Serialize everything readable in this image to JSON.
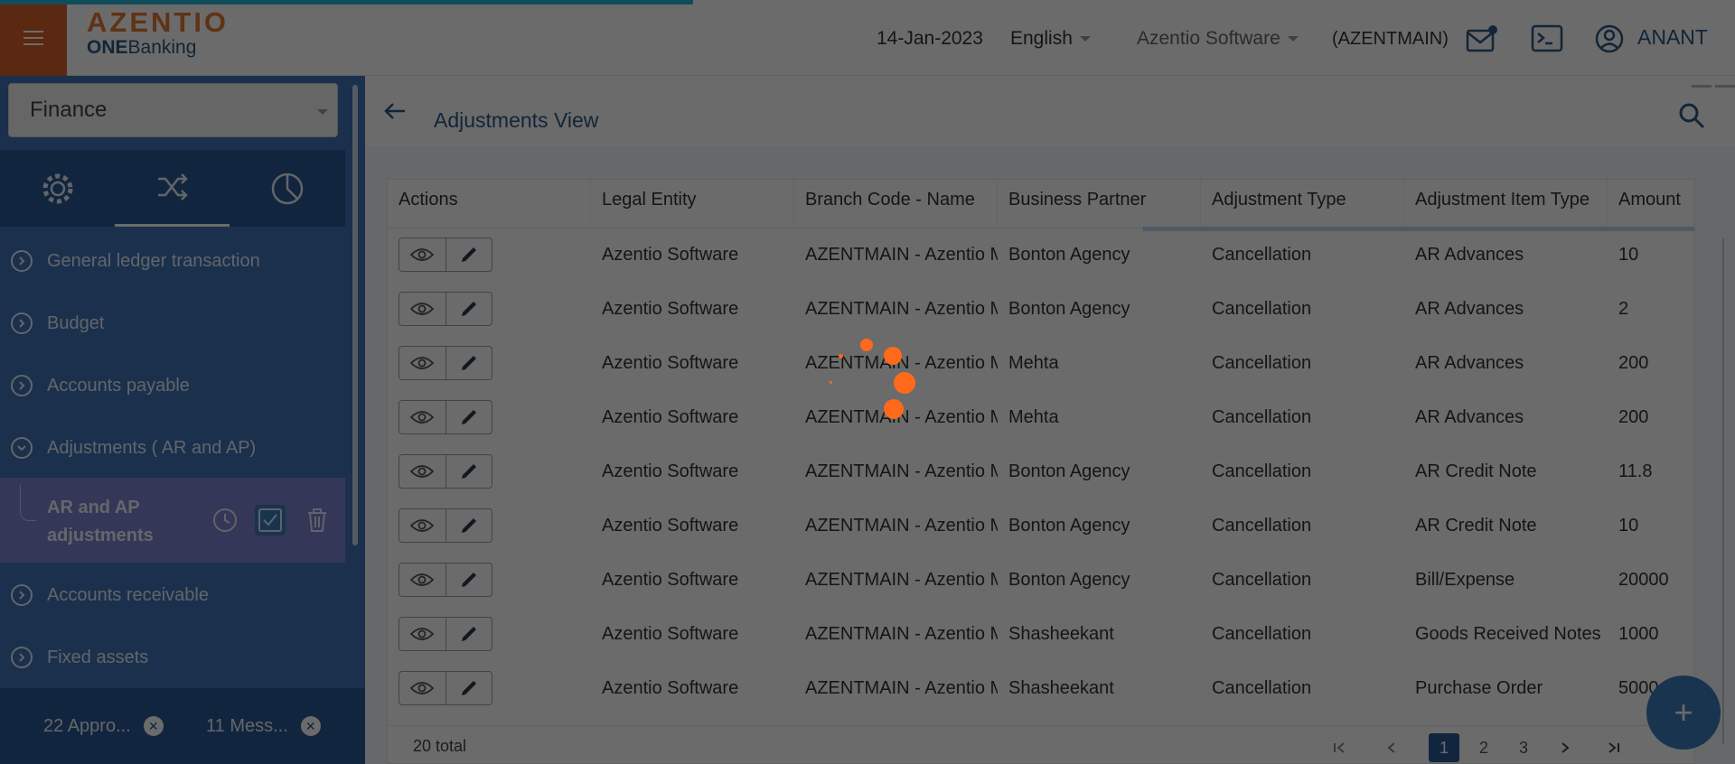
{
  "header": {
    "brand": "AZENTIO",
    "product_prefix": "ONE",
    "product_suffix": "Banking",
    "date": "14-Jan-2023",
    "language": "English",
    "company": "Azentio Software",
    "branch_code": "(AZENTMAIN)",
    "user": "ANANT"
  },
  "sidebar": {
    "module": "Finance",
    "tabs": [
      "settings-gear",
      "shuffle",
      "pie-chart"
    ],
    "items": [
      {
        "label": "General ledger transaction",
        "expanded": false
      },
      {
        "label": "Budget",
        "expanded": false
      },
      {
        "label": "Accounts payable",
        "expanded": false
      },
      {
        "label": "Adjustments ( AR and AP)",
        "expanded": true
      },
      {
        "label": "Accounts receivable",
        "expanded": false
      },
      {
        "label": "Fixed assets",
        "expanded": false
      }
    ],
    "sub_item": {
      "label": "AR and AP adjustments"
    },
    "bottom_pills": [
      {
        "label": "22 Appro..."
      },
      {
        "label": "11 Mess..."
      }
    ]
  },
  "main": {
    "title": "Adjustments View",
    "columns": [
      "Actions",
      "Legal Entity",
      "Branch Code - Name",
      "Business Partner",
      "Adjustment Type",
      "Adjustment Item Type",
      "Amount"
    ],
    "rows": [
      {
        "legal_entity": "Azentio Software",
        "branch": "AZENTMAIN - Azentio Main",
        "partner": "Bonton Agency",
        "adj_type": "Cancellation",
        "item_type": "AR Advances",
        "amount": "10"
      },
      {
        "legal_entity": "Azentio Software",
        "branch": "AZENTMAIN - Azentio Main",
        "partner": "Bonton Agency",
        "adj_type": "Cancellation",
        "item_type": "AR Advances",
        "amount": "2"
      },
      {
        "legal_entity": "Azentio Software",
        "branch": "AZENTMAIN - Azentio Main",
        "partner": "Mehta",
        "adj_type": "Cancellation",
        "item_type": "AR Advances",
        "amount": "200"
      },
      {
        "legal_entity": "Azentio Software",
        "branch": "AZENTMAIN - Azentio Main",
        "partner": "Mehta",
        "adj_type": "Cancellation",
        "item_type": "AR Advances",
        "amount": "200"
      },
      {
        "legal_entity": "Azentio Software",
        "branch": "AZENTMAIN - Azentio Main",
        "partner": "Bonton Agency",
        "adj_type": "Cancellation",
        "item_type": "AR Credit Note",
        "amount": "11.8"
      },
      {
        "legal_entity": "Azentio Software",
        "branch": "AZENTMAIN - Azentio Main",
        "partner": "Bonton Agency",
        "adj_type": "Cancellation",
        "item_type": "AR Credit Note",
        "amount": "10"
      },
      {
        "legal_entity": "Azentio Software",
        "branch": "AZENTMAIN - Azentio Main",
        "partner": "Bonton Agency",
        "adj_type": "Cancellation",
        "item_type": "Bill/Expense",
        "amount": "20000"
      },
      {
        "legal_entity": "Azentio Software",
        "branch": "AZENTMAIN - Azentio Main",
        "partner": "Shasheekant",
        "adj_type": "Cancellation",
        "item_type": "Goods Received Notes",
        "amount": "1000"
      },
      {
        "legal_entity": "Azentio Software",
        "branch": "AZENTMAIN - Azentio Main",
        "partner": "Shasheekant",
        "adj_type": "Cancellation",
        "item_type": "Purchase Order",
        "amount": "5000"
      }
    ],
    "total_text": "20 total",
    "pages": [
      "1",
      "2",
      "3"
    ],
    "current_page": "1"
  },
  "fab": {
    "label": "+"
  },
  "colors": {
    "accent_orange": "#d9622a",
    "sidebar_blue": "#3f74b8",
    "sidebar_dark": "#2c5a96",
    "active_sub": "#7c83cf",
    "spinner": "#ff6a1a",
    "progress": "#29b6d8"
  },
  "loading": true
}
